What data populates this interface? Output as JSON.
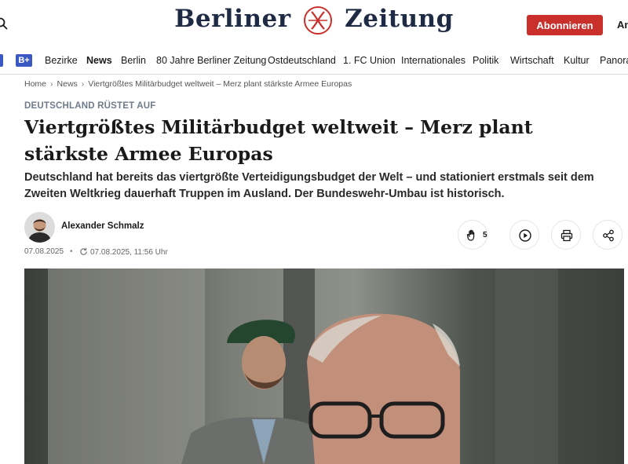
{
  "header": {
    "logo_left": "Berliner",
    "logo_right": "Zeitung",
    "subscribe_label": "Abonnieren",
    "login_label": "An"
  },
  "nav": {
    "items": [
      "Bezirke",
      "News",
      "Berlin",
      "80 Jahre Berliner Zeitung",
      "Ostdeutschland",
      "1. FC Union",
      "Internationales",
      "Politik",
      "Wirtschaft",
      "Kultur",
      "Panora"
    ],
    "active": "News",
    "plus_badge": "B+"
  },
  "breadcrumb": {
    "home": "Home",
    "news": "News",
    "current": "Viertgrößtes Militärbudget weltweit – Merz plant stärkste Armee Europas"
  },
  "article": {
    "kicker": "DEUTSCHLAND RÜSTET AUF",
    "headline": "Viertgrößtes Militärbudget weltweit – Merz plant stärkste Armee Europas",
    "lead": "Deutschland hat bereits das viertgrößte Verteidigungsbudget der Welt – und stationiert erstmals seit dem Zweiten Weltkrieg dauerhaft Truppen im Ausland. Der Bundeswehr-Umbau ist historisch.",
    "author": "Alexander Schmalz",
    "date": "07.08.2025",
    "dot": "•",
    "updated": "07.08.2025, 11:56 Uhr",
    "clap_count": "5"
  },
  "colors": {
    "brand_red": "#c9302c",
    "logo_navy": "#1f2a44",
    "plus_blue": "#3b57c4"
  }
}
